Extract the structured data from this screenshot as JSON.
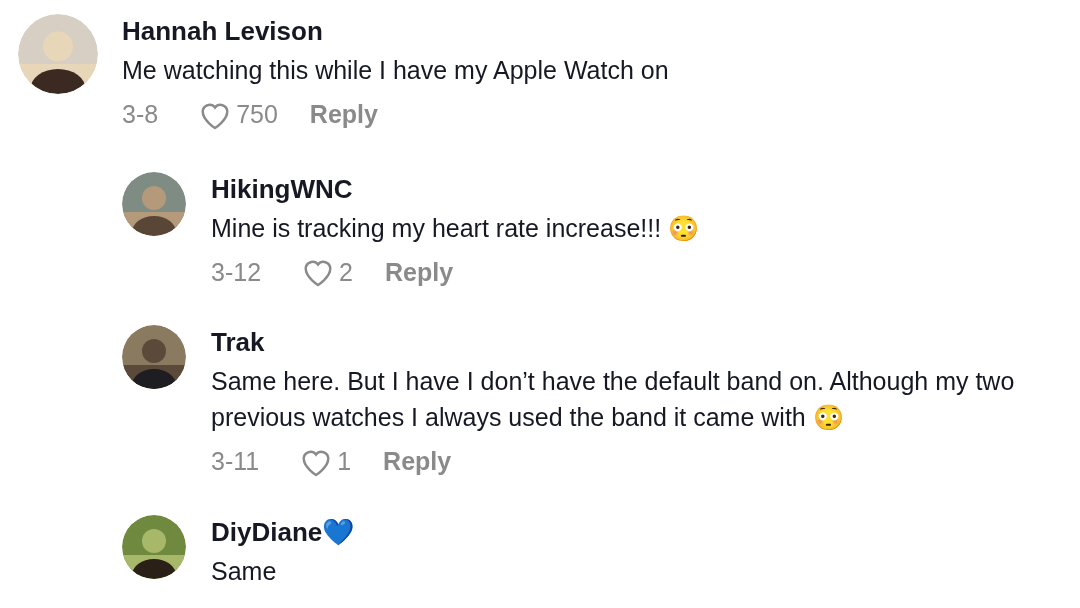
{
  "comments": [
    {
      "author": "Hannah Levison",
      "text": "Me watching this while I have my Apple Watch on",
      "date": "3-8",
      "likes": "750",
      "reply": "Reply",
      "children": [
        {
          "author": "HikingWNC",
          "text": "Mine is tracking my heart rate increase!!! 😳",
          "date": "3-12",
          "likes": "2",
          "reply": "Reply"
        },
        {
          "author": "Trak",
          "text": "Same here. But I have I don’t have the default band on. Although my two previous watches I always used the band it came with 😳",
          "date": "3-11",
          "likes": "1",
          "reply": "Reply"
        },
        {
          "author": "DiyDiane💙",
          "text": "Same"
        }
      ]
    }
  ]
}
